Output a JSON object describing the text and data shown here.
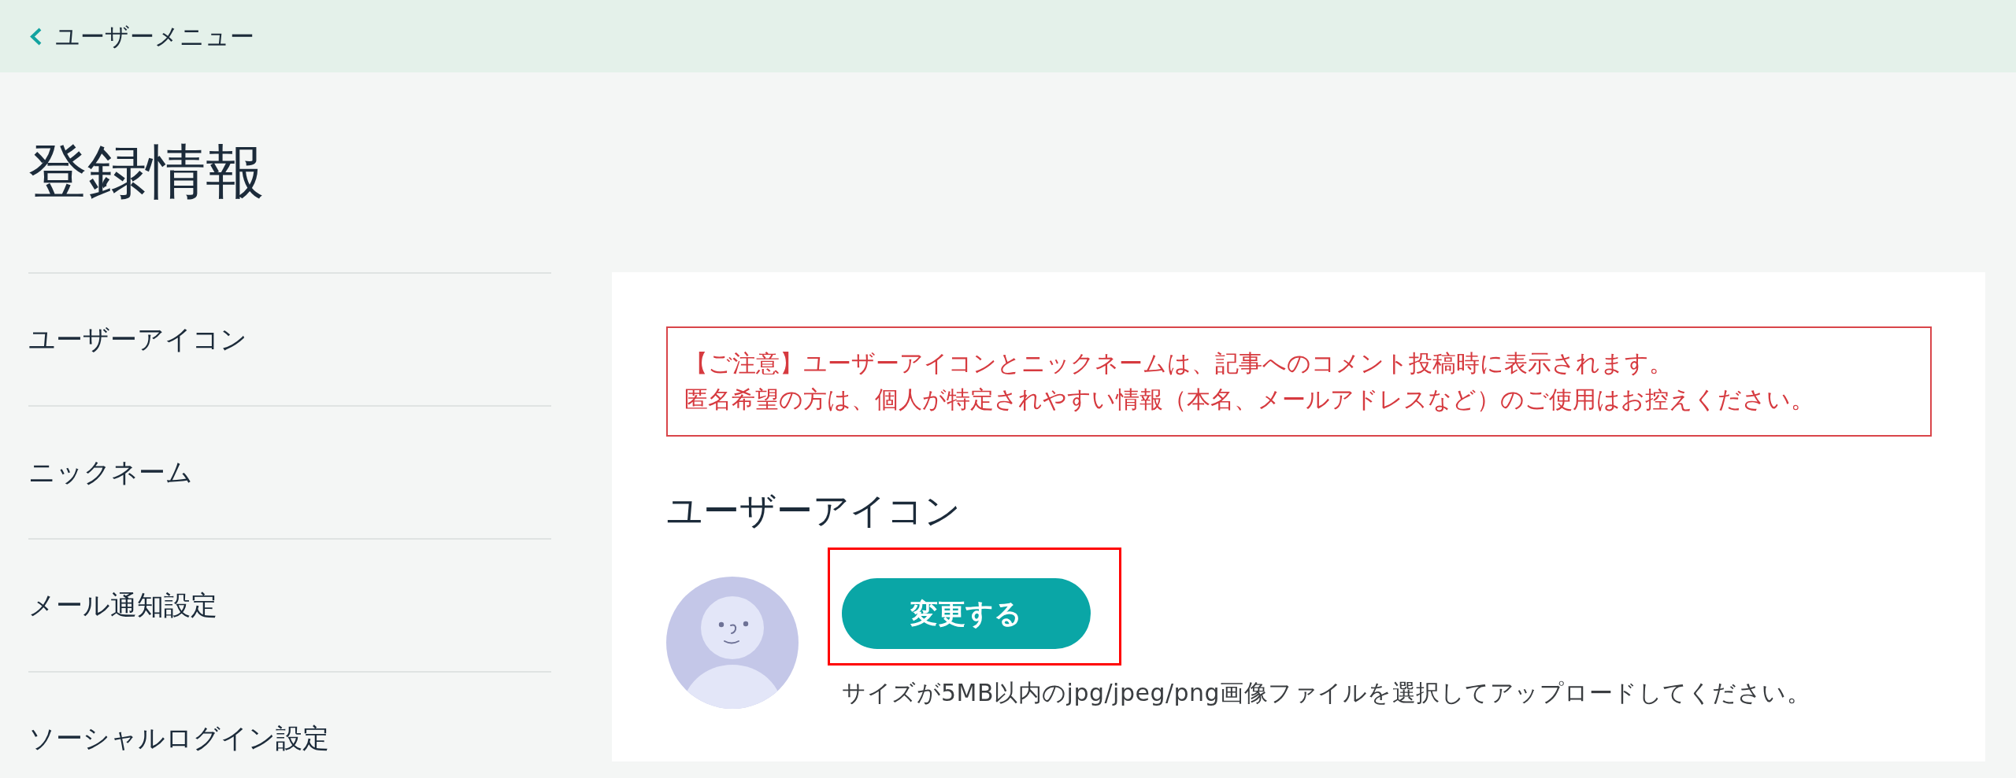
{
  "header": {
    "back_link": "ユーザーメニュー"
  },
  "page_title": "登録情報",
  "sidebar": {
    "items": [
      {
        "label": "ユーザーアイコン"
      },
      {
        "label": "ニックネーム"
      },
      {
        "label": "メール通知設定"
      },
      {
        "label": "ソーシャルログイン設定"
      }
    ]
  },
  "panel": {
    "notice": {
      "lines": [
        "【ご注意】ユーザーアイコンとニックネームは、記事へのコメント投稿時に表示されます。",
        "匿名希望の方は、個人が特定されやすい情報（本名、メールアドレスなど）のご使用はお控えください。"
      ]
    },
    "section_title": "ユーザーアイコン",
    "change_button": {
      "label": "変更する",
      "highlighted": true
    },
    "help_text": "サイズが5MB以内のjpg/jpeg/png画像ファイルを選択してアップロードしてください。"
  }
}
